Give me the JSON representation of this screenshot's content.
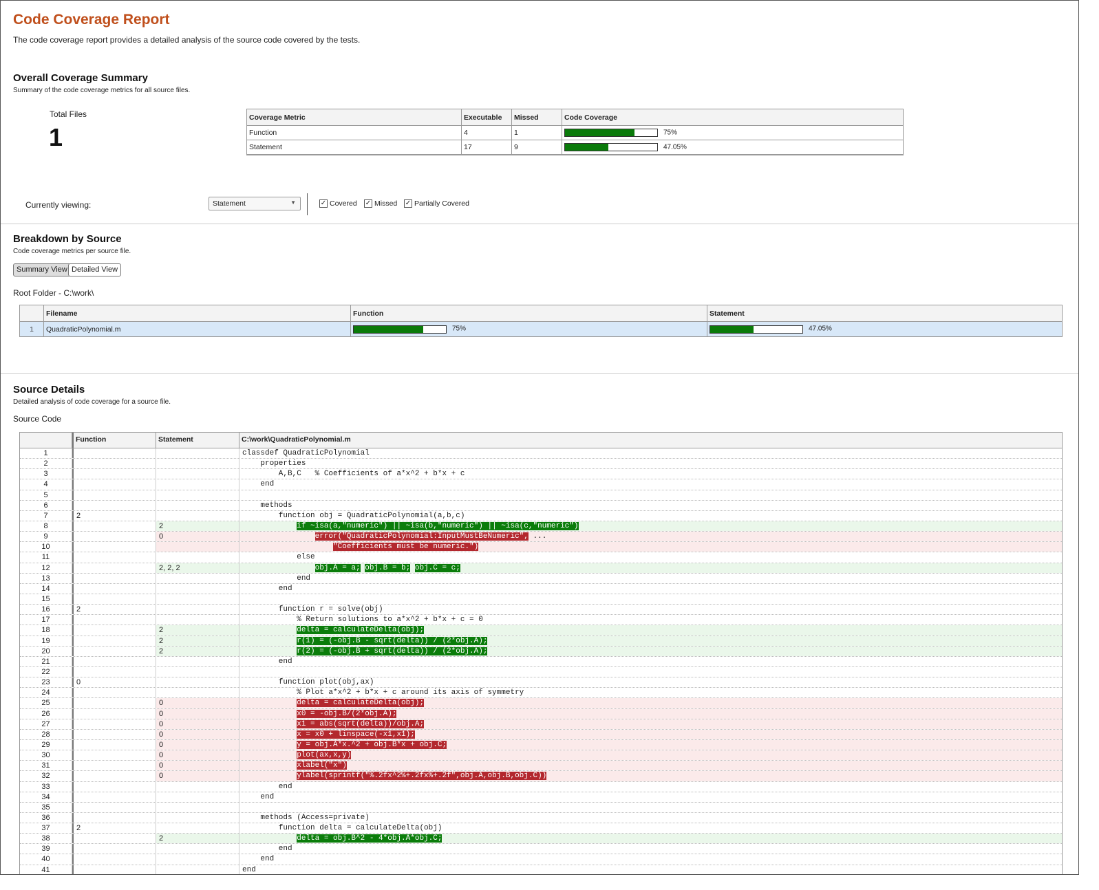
{
  "report": {
    "title": "Code Coverage Report",
    "description": "The code coverage report provides a detailed analysis of the source code covered by the tests."
  },
  "summary": {
    "title": "Overall Coverage Summary",
    "description": "Summary of the code coverage metrics for all source files.",
    "total_files_label": "Total Files",
    "total_files_value": "1",
    "table": {
      "headers": [
        "Coverage Metric",
        "Executable",
        "Missed",
        "Code Coverage"
      ],
      "rows": [
        {
          "metric": "Function",
          "executable": "4",
          "missed": "1",
          "coverage": "75%",
          "fraction": 0.75
        },
        {
          "metric": "Statement",
          "executable": "17",
          "missed": "9",
          "coverage": "47.05%",
          "fraction": 0.4705
        }
      ]
    }
  },
  "viewing": {
    "label": "Currently viewing:",
    "selected": "Statement",
    "checks": [
      {
        "label": "Covered",
        "checked": true
      },
      {
        "label": "Missed",
        "checked": true
      },
      {
        "label": "Partially Covered",
        "checked": true
      }
    ]
  },
  "breakdown": {
    "title": "Breakdown by Source",
    "description": "Code coverage metrics per source file.",
    "summary_view_label": "Summary View",
    "detailed_view_label": "Detailed View",
    "root_folder": "Root Folder - C:\\work\\",
    "headers": [
      "Filename",
      "Function",
      "Statement"
    ],
    "rows": [
      {
        "index": "1",
        "filename": "QuadraticPolynomial.m",
        "function": "75%",
        "function_fraction": 0.75,
        "statement": "47.05%",
        "statement_fraction": 0.4705
      }
    ]
  },
  "details": {
    "title": "Source Details",
    "description": "Detailed analysis of code coverage for a source file.",
    "source_code_label": "Source Code",
    "headers": {
      "function": "Function",
      "statement": "Statement",
      "file": "C:\\work\\QuadraticPolynomial.m"
    },
    "colors": {
      "covered": "#0b7d0b",
      "missed": "#b3282e"
    },
    "lines": [
      {
        "n": "1",
        "f": "",
        "s": "",
        "status": "",
        "segments": [
          {
            "t": "classdef QuadraticPolynomial"
          }
        ]
      },
      {
        "n": "2",
        "f": "",
        "s": "",
        "status": "",
        "segments": [
          {
            "t": "    properties"
          }
        ]
      },
      {
        "n": "3",
        "f": "",
        "s": "",
        "status": "",
        "segments": [
          {
            "t": "        A,B,C   % Coefficients of a*x^2 + b*x + c"
          }
        ]
      },
      {
        "n": "4",
        "f": "",
        "s": "",
        "status": "",
        "segments": [
          {
            "t": "    end"
          }
        ]
      },
      {
        "n": "5",
        "f": "",
        "s": "",
        "status": "",
        "segments": [
          {
            "t": ""
          }
        ]
      },
      {
        "n": "6",
        "f": "",
        "s": "",
        "status": "",
        "segments": [
          {
            "t": "    methods"
          }
        ]
      },
      {
        "n": "7",
        "f": "2",
        "s": "",
        "status": "",
        "segments": [
          {
            "t": "        function obj = QuadraticPolynomial(a,b,c)"
          }
        ]
      },
      {
        "n": "8",
        "f": "",
        "s": "2",
        "status": "covered",
        "segments": [
          {
            "t": "            "
          },
          {
            "t": "if ~isa(a,\"numeric\") || ~isa(b,\"numeric\") || ~isa(c,\"numeric\")",
            "hl": "green"
          }
        ]
      },
      {
        "n": "9",
        "f": "",
        "s": "0",
        "status": "missed",
        "segments": [
          {
            "t": "                "
          },
          {
            "t": "error(\"QuadraticPolynomial:InputMustBeNumeric\",",
            "hl": "red"
          },
          {
            "t": " ..."
          }
        ]
      },
      {
        "n": "10",
        "f": "",
        "s": "",
        "status": "missed",
        "segments": [
          {
            "t": "                    "
          },
          {
            "t": "\"Coefficients must be numeric.\")",
            "hl": "red"
          }
        ]
      },
      {
        "n": "11",
        "f": "",
        "s": "",
        "status": "",
        "segments": [
          {
            "t": "            else"
          }
        ]
      },
      {
        "n": "12",
        "f": "",
        "s": "2, 2, 2",
        "status": "covered",
        "segments": [
          {
            "t": "                "
          },
          {
            "t": "obj.A = a;",
            "hl": "green"
          },
          {
            "t": " "
          },
          {
            "t": "obj.B = b;",
            "hl": "green"
          },
          {
            "t": " "
          },
          {
            "t": "obj.C = c;",
            "hl": "green"
          }
        ]
      },
      {
        "n": "13",
        "f": "",
        "s": "",
        "status": "",
        "segments": [
          {
            "t": "            end"
          }
        ]
      },
      {
        "n": "14",
        "f": "",
        "s": "",
        "status": "",
        "segments": [
          {
            "t": "        end"
          }
        ]
      },
      {
        "n": "15",
        "f": "",
        "s": "",
        "status": "",
        "segments": [
          {
            "t": ""
          }
        ]
      },
      {
        "n": "16",
        "f": "2",
        "s": "",
        "status": "",
        "segments": [
          {
            "t": "        function r = solve(obj)"
          }
        ]
      },
      {
        "n": "17",
        "f": "",
        "s": "",
        "status": "",
        "segments": [
          {
            "t": "            % Return solutions to a*x^2 + b*x + c = 0"
          }
        ]
      },
      {
        "n": "18",
        "f": "",
        "s": "2",
        "status": "covered",
        "segments": [
          {
            "t": "            "
          },
          {
            "t": "delta = calculateDelta(obj);",
            "hl": "green"
          }
        ]
      },
      {
        "n": "19",
        "f": "",
        "s": "2",
        "status": "covered",
        "segments": [
          {
            "t": "            "
          },
          {
            "t": "r(1) = (-obj.B - sqrt(delta)) / (2*obj.A);",
            "hl": "green"
          }
        ]
      },
      {
        "n": "20",
        "f": "",
        "s": "2",
        "status": "covered",
        "segments": [
          {
            "t": "            "
          },
          {
            "t": "r(2) = (-obj.B + sqrt(delta)) / (2*obj.A);",
            "hl": "green"
          }
        ]
      },
      {
        "n": "21",
        "f": "",
        "s": "",
        "status": "",
        "segments": [
          {
            "t": "        end"
          }
        ]
      },
      {
        "n": "22",
        "f": "",
        "s": "",
        "status": "",
        "segments": [
          {
            "t": ""
          }
        ]
      },
      {
        "n": "23",
        "f": "0",
        "s": "",
        "status": "",
        "segments": [
          {
            "t": "        function plot(obj,ax)"
          }
        ]
      },
      {
        "n": "24",
        "f": "",
        "s": "",
        "status": "",
        "segments": [
          {
            "t": "            % Plot a*x^2 + b*x + c around its axis of symmetry"
          }
        ]
      },
      {
        "n": "25",
        "f": "",
        "s": "0",
        "status": "missed",
        "segments": [
          {
            "t": "            "
          },
          {
            "t": "delta = calculateDelta(obj);",
            "hl": "red"
          }
        ]
      },
      {
        "n": "26",
        "f": "",
        "s": "0",
        "status": "missed",
        "segments": [
          {
            "t": "            "
          },
          {
            "t": "x0 = -obj.B/(2*obj.A);",
            "hl": "red"
          }
        ]
      },
      {
        "n": "27",
        "f": "",
        "s": "0",
        "status": "missed",
        "segments": [
          {
            "t": "            "
          },
          {
            "t": "x1 = abs(sqrt(delta))/obj.A;",
            "hl": "red"
          }
        ]
      },
      {
        "n": "28",
        "f": "",
        "s": "0",
        "status": "missed",
        "segments": [
          {
            "t": "            "
          },
          {
            "t": "x = x0 + linspace(-x1,x1);",
            "hl": "red"
          }
        ]
      },
      {
        "n": "29",
        "f": "",
        "s": "0",
        "status": "missed",
        "segments": [
          {
            "t": "            "
          },
          {
            "t": "y = obj.A*x.^2 + obj.B*x + obj.C;",
            "hl": "red"
          }
        ]
      },
      {
        "n": "30",
        "f": "",
        "s": "0",
        "status": "missed",
        "segments": [
          {
            "t": "            "
          },
          {
            "t": "plot(ax,x,y)",
            "hl": "red"
          }
        ]
      },
      {
        "n": "31",
        "f": "",
        "s": "0",
        "status": "missed",
        "segments": [
          {
            "t": "            "
          },
          {
            "t": "xlabel(\"x\")",
            "hl": "red"
          }
        ]
      },
      {
        "n": "32",
        "f": "",
        "s": "0",
        "status": "missed",
        "segments": [
          {
            "t": "            "
          },
          {
            "t": "ylabel(sprintf(\"%.2fx^2%+.2fx%+.2f\",obj.A,obj.B,obj.C))",
            "hl": "red"
          }
        ]
      },
      {
        "n": "33",
        "f": "",
        "s": "",
        "status": "",
        "segments": [
          {
            "t": "        end"
          }
        ]
      },
      {
        "n": "34",
        "f": "",
        "s": "",
        "status": "",
        "segments": [
          {
            "t": "    end"
          }
        ]
      },
      {
        "n": "35",
        "f": "",
        "s": "",
        "status": "",
        "segments": [
          {
            "t": ""
          }
        ]
      },
      {
        "n": "36",
        "f": "",
        "s": "",
        "status": "",
        "segments": [
          {
            "t": "    methods (Access=private)"
          }
        ]
      },
      {
        "n": "37",
        "f": "2",
        "s": "",
        "status": "",
        "segments": [
          {
            "t": "        function delta = calculateDelta(obj)"
          }
        ]
      },
      {
        "n": "38",
        "f": "",
        "s": "2",
        "status": "covered",
        "segments": [
          {
            "t": "            "
          },
          {
            "t": "delta = obj.B^2 - 4*obj.A*obj.C;",
            "hl": "green"
          }
        ]
      },
      {
        "n": "39",
        "f": "",
        "s": "",
        "status": "",
        "segments": [
          {
            "t": "        end"
          }
        ]
      },
      {
        "n": "40",
        "f": "",
        "s": "",
        "status": "",
        "segments": [
          {
            "t": "    end"
          }
        ]
      },
      {
        "n": "41",
        "f": "",
        "s": "",
        "status": "",
        "segments": [
          {
            "t": "end"
          }
        ]
      }
    ]
  }
}
